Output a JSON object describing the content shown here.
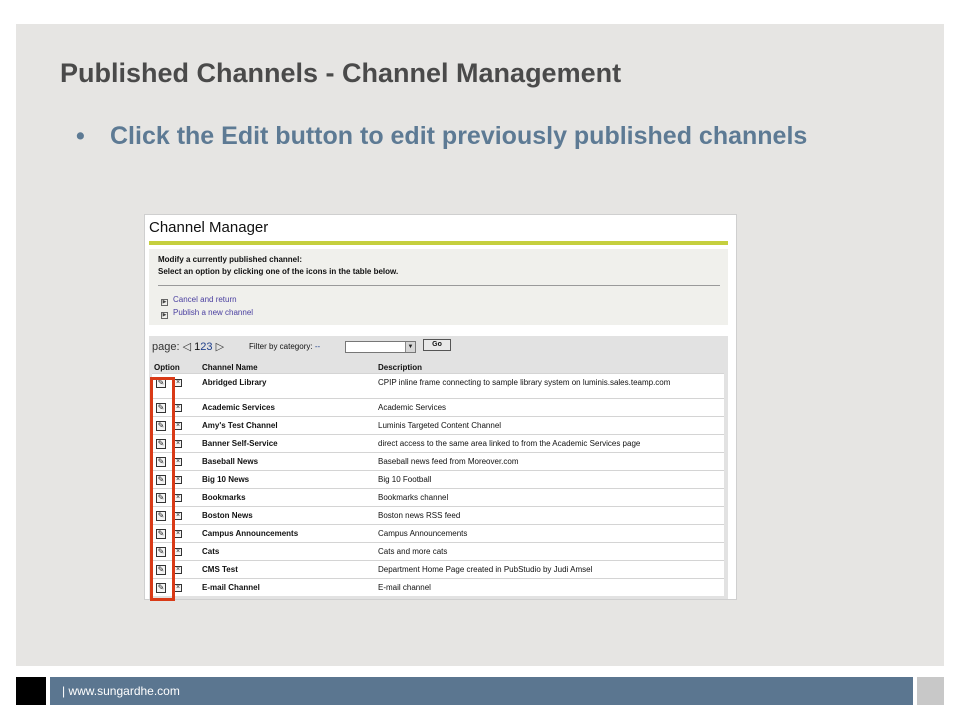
{
  "slide": {
    "title": "Published Channels - Channel Management",
    "bullet": "Click the Edit button to edit previously published channels",
    "bullet_symbol": "•",
    "footer_text": "| www.sungardhe.com",
    "colors": {
      "title": "#4a4a4a",
      "bullet": "#5d7a94",
      "footer_bar": "#5b7690",
      "highlight": "#d93a17",
      "accent_line": "#c5cf3e"
    }
  },
  "channel_manager": {
    "title": "Channel Manager",
    "instruction_1": "Modify a currently published channel:",
    "instruction_2": "Select an option by clicking one of the icons in the table below.",
    "links": [
      {
        "label": "Cancel and return"
      },
      {
        "label": "Publish a new channel"
      }
    ],
    "pager": {
      "label": "page:",
      "prev": "◁",
      "pages": [
        "1",
        "2",
        "3"
      ],
      "next": "▷",
      "current": "1"
    },
    "filter": {
      "label": "Filter by category:",
      "selected": "--",
      "go_label": "Go"
    },
    "columns": {
      "option": "Option",
      "name": "Channel Name",
      "description": "Description"
    },
    "icons": {
      "edit": "edit-icon",
      "delete": "delete-icon"
    },
    "rows": [
      {
        "name": "Abridged Library",
        "description": "CPIP inline frame connecting to sample library system on luminis.sales.teamp.com"
      },
      {
        "name": "Academic Services",
        "description": "Academic Services"
      },
      {
        "name": "Amy's Test Channel",
        "description": "Luminis Targeted Content Channel"
      },
      {
        "name": "Banner Self-Service",
        "description": "direct access to the same area linked to from the Academic Services page"
      },
      {
        "name": "Baseball News",
        "description": "Baseball news feed from Moreover.com"
      },
      {
        "name": "Big 10 News",
        "description": "Big 10 Football"
      },
      {
        "name": "Bookmarks",
        "description": "Bookmarks channel"
      },
      {
        "name": "Boston News",
        "description": "Boston news RSS feed"
      },
      {
        "name": "Campus Announcements",
        "description": "Campus Announcements"
      },
      {
        "name": "Cats",
        "description": "Cats and more cats"
      },
      {
        "name": "CMS Test",
        "description": "Department Home Page created in PubStudio by Judi Amsel"
      },
      {
        "name": "E-mail Channel",
        "description": "E-mail channel"
      }
    ]
  }
}
